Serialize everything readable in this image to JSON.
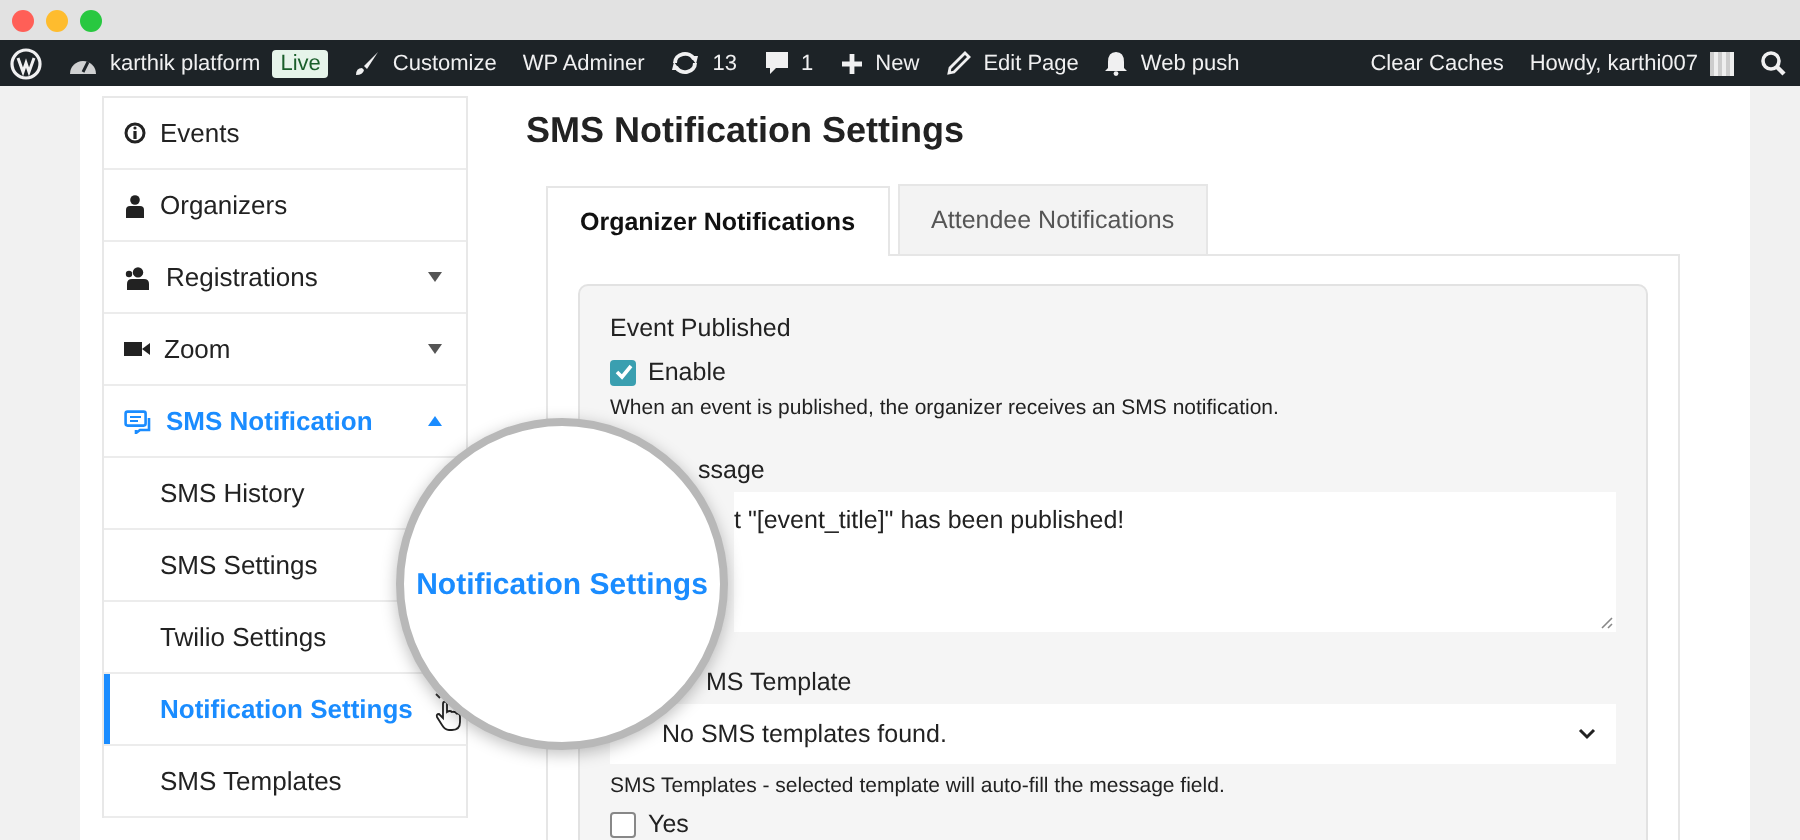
{
  "window": {
    "controls": [
      {
        "color": "#ff5f57"
      },
      {
        "color": "#febc2e"
      },
      {
        "color": "#28c840"
      }
    ]
  },
  "admin_bar": {
    "left": [
      {
        "kind": "logo"
      },
      {
        "kind": "site",
        "label": "karthik platform",
        "badge": "Live"
      },
      {
        "kind": "customize",
        "label": "Customize"
      },
      {
        "kind": "text",
        "label": "WP Adminer"
      },
      {
        "kind": "updates",
        "label": "13"
      },
      {
        "kind": "comments",
        "label": "1"
      },
      {
        "kind": "new",
        "label": "New"
      },
      {
        "kind": "edit",
        "label": "Edit Page"
      },
      {
        "kind": "notify",
        "label": "Web push"
      }
    ],
    "right": [
      {
        "kind": "text",
        "label": "Clear Caches"
      },
      {
        "kind": "account",
        "label": "Howdy, karthi007"
      },
      {
        "kind": "search"
      }
    ]
  },
  "sidebar": {
    "items": [
      {
        "kind": "link",
        "label": "Events",
        "selected": false
      },
      {
        "kind": "link",
        "label": "Organizers",
        "selected": false
      },
      {
        "kind": "group",
        "label": "Registrations",
        "selected": false,
        "expanded": false
      },
      {
        "kind": "group",
        "label": "Zoom",
        "selected": false,
        "expanded": false
      },
      {
        "kind": "group",
        "label": "SMS Notification",
        "selected": true,
        "expanded": true,
        "children": [
          {
            "label": "SMS History",
            "selected": false
          },
          {
            "label": "SMS Settings",
            "selected": false
          },
          {
            "label": "Twilio Settings",
            "selected": false
          },
          {
            "label": "Notification Settings",
            "selected": true
          },
          {
            "label": "SMS Templates",
            "selected": false
          }
        ]
      }
    ]
  },
  "page": {
    "title": "SMS Notification Settings",
    "tabs": [
      {
        "label": "Organizer Notifications",
        "selected": true
      },
      {
        "label": "Attendee Notifications",
        "selected": false
      }
    ],
    "section": {
      "heading": "Event Published",
      "enable": {
        "label": "Enable",
        "checked": true
      },
      "help": "When an event is published, the organizer receives an SMS notification.",
      "message_label": "ssage",
      "message_value": "t \"[event_title]\" has been published!",
      "template_label": "MS Template",
      "template_value": "No SMS templates found.",
      "template_help": "SMS Templates - selected template will auto-fill the message field.",
      "yes": {
        "label": "Yes",
        "checked": false
      }
    }
  },
  "magnifier": {
    "label": "Notification Settings"
  }
}
